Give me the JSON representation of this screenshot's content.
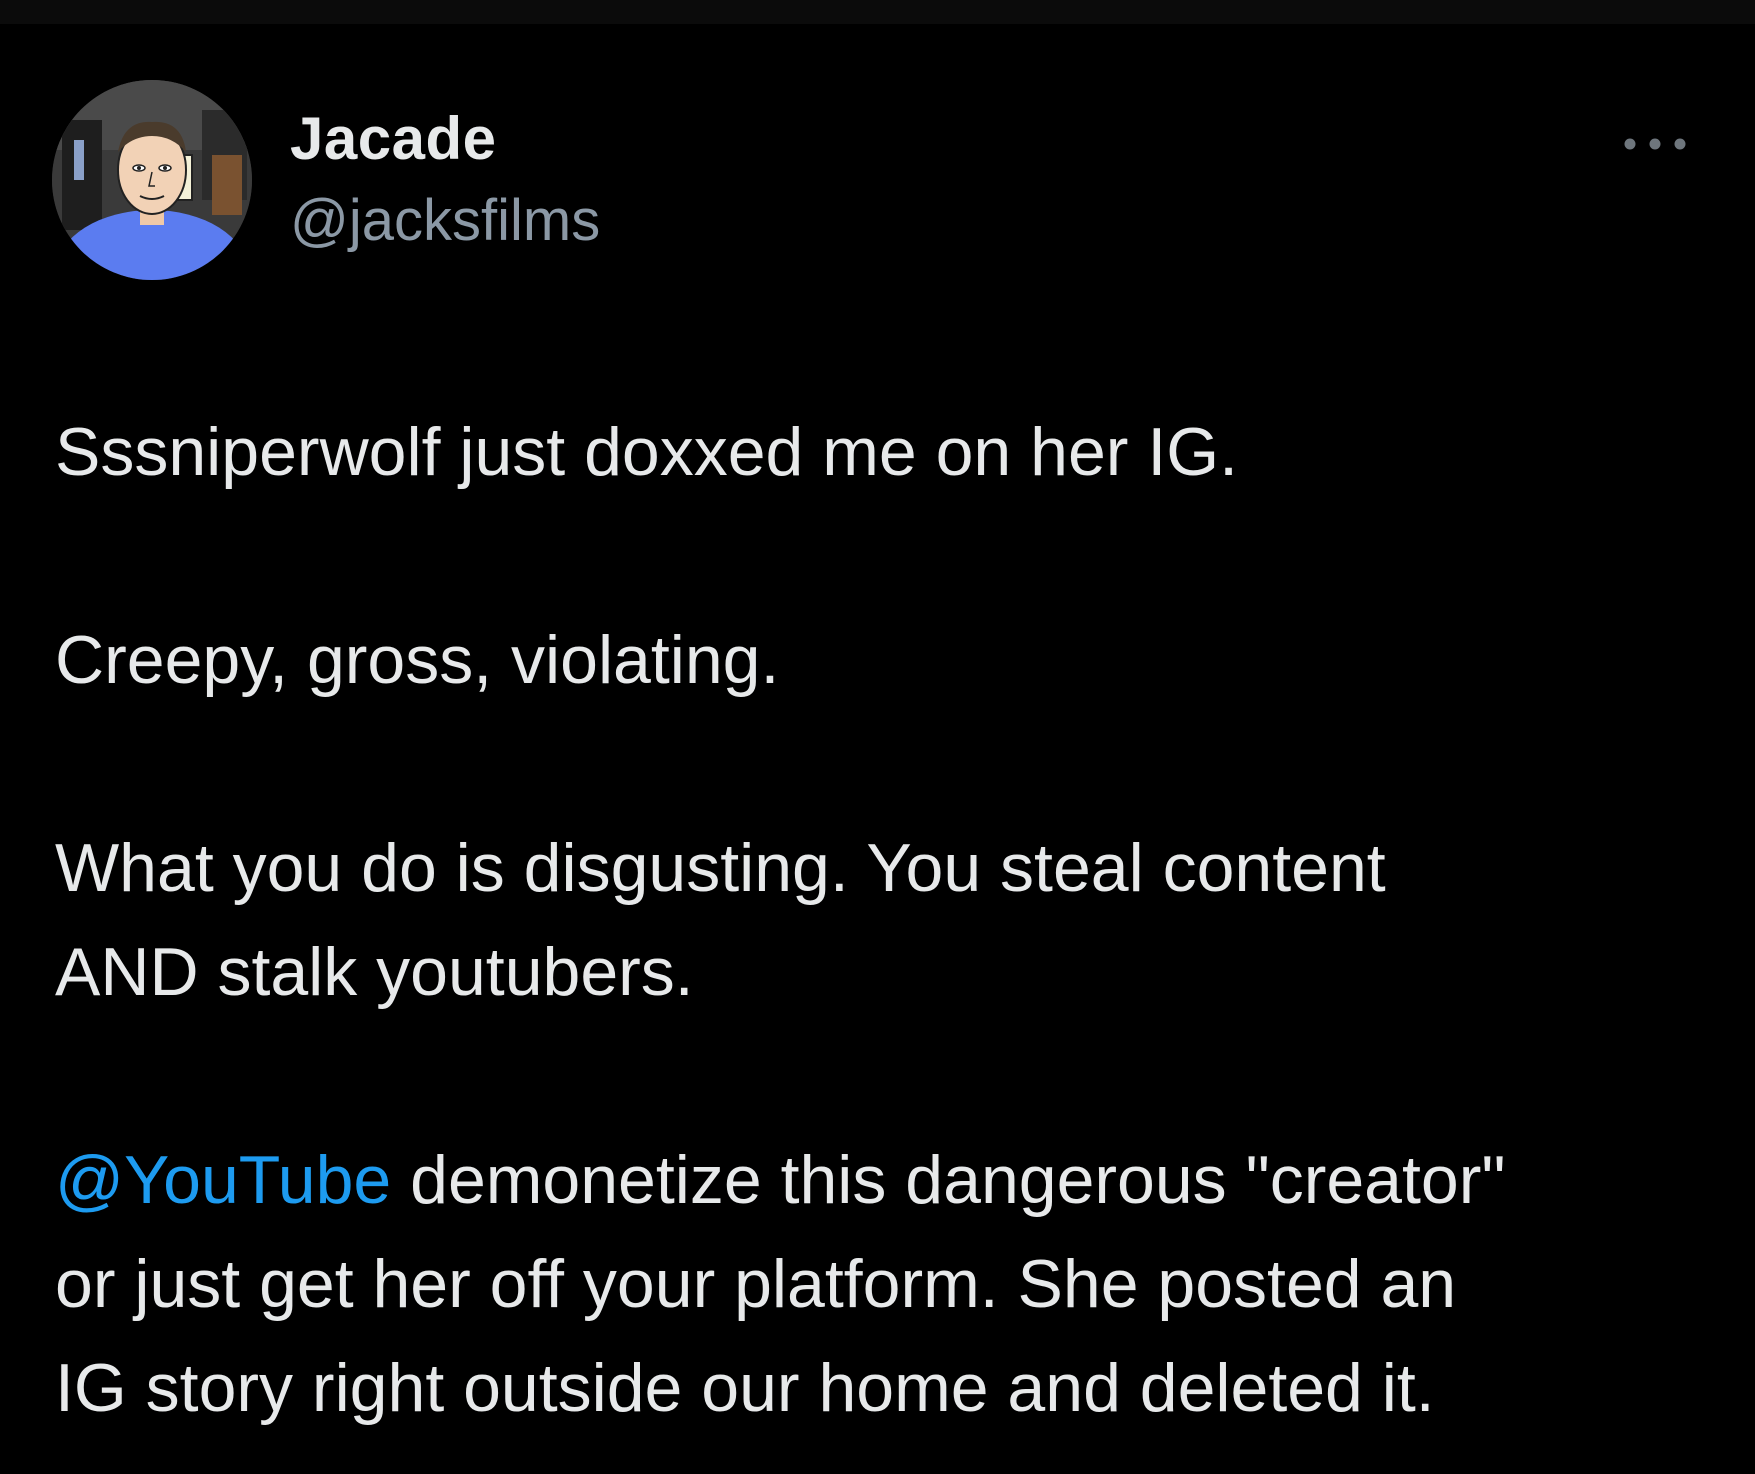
{
  "author": {
    "display_name": "Jacade",
    "handle": "@jacksfilms",
    "avatar_icon": "profile-photo"
  },
  "menu": {
    "icon": "more-options-icon"
  },
  "tweet": {
    "p1": {
      "l1": "Sssniperwolf just doxxed me on her IG."
    },
    "p2": {
      "l1": "Creepy, gross, violating."
    },
    "p3": {
      "l1": "What you do is disgusting. You steal content",
      "l2": "AND stalk youtubers."
    },
    "p4": {
      "mention": "@YouTube",
      "l1_rest": " demonetize this dangerous \"creator\"",
      "l2": "or just get her off your platform. She posted an",
      "l3": "IG story right outside our home and deleted it."
    }
  },
  "colors": {
    "background": "#000000",
    "text": "#e7e9ea",
    "secondary_text": "#8b98a5",
    "link": "#1d9bf0"
  }
}
